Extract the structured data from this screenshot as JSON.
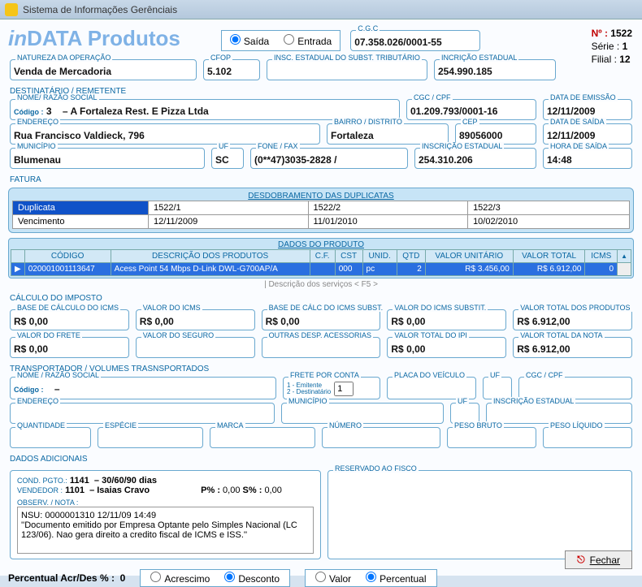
{
  "window": {
    "title": "Sistema de Informações Gerênciais"
  },
  "brand": {
    "prefix": "in",
    "rest": "DATA Produtos"
  },
  "direction": {
    "out": "Saída",
    "in": "Entrada",
    "selected": "out"
  },
  "header": {
    "cgc": {
      "label": "C.G.C",
      "value": "07.358.026/0001-55"
    },
    "natureza": {
      "label": "NATUREZA DA OPERAÇÃO",
      "value": "Venda de Mercadoria"
    },
    "cfop": {
      "label": "CFOP",
      "value": "5.102"
    },
    "insc_subst": {
      "label": "INSC. ESTADUAL DO SUBST. TRIBUTÁRIO",
      "value": ""
    },
    "insc_est": {
      "label": "INCRIÇÃO ESTADUAL",
      "value": "254.990.185"
    },
    "numero": {
      "label": "Nº :",
      "value": "1522"
    },
    "serie": {
      "label": "Série :",
      "value": "1"
    },
    "filial": {
      "label": "Filial :",
      "value": "12"
    }
  },
  "dest": {
    "title": "DESTINATÁRIO / REMETENTE",
    "nome": {
      "label": "NOME/ RAZÃO SOCIAL",
      "code_lbl": "Código :",
      "code": "3",
      "dash": "–",
      "value": "A Fortaleza Rest. E Pizza Ltda"
    },
    "cgc_cpf": {
      "label": "CGC / CPF",
      "value": "01.209.793/0001-16"
    },
    "data_emissao": {
      "label": "DATA DE EMISSÃO",
      "value": "12/11/2009"
    },
    "endereco": {
      "label": "ENDEREÇO",
      "value": "Rua Francisco Valdieck, 796"
    },
    "bairro": {
      "label": "BAIRRO / DISTRITO",
      "value": "Fortaleza"
    },
    "cep": {
      "label": "CEP",
      "value": "89056000"
    },
    "data_saida": {
      "label": "DATA DE SAÍDA",
      "value": "12/11/2009"
    },
    "municipio": {
      "label": "MUNICÍPIO",
      "value": "Blumenau"
    },
    "uf": {
      "label": "UF",
      "value": "SC"
    },
    "fone": {
      "label": "FONE / FAX",
      "value": "(0**47)3035-2828 /"
    },
    "insc_est": {
      "label": "INSCRIÇÃO ESTADUAL",
      "value": "254.310.206"
    },
    "hora_saida": {
      "label": "HORA DE SAÍDA",
      "value": "14:48"
    }
  },
  "fatura": {
    "title": "FATURA",
    "desdo": "DESDOBRAMENTO DAS DUPLICATAS",
    "rows": [
      {
        "h": "Duplicata",
        "c1": "1522/1",
        "c2": "1522/2",
        "c3": "1522/3"
      },
      {
        "h": "Vencimento",
        "c1": "12/11/2009",
        "c2": "11/01/2010",
        "c3": "10/02/2010"
      }
    ]
  },
  "produtos": {
    "title": "DADOS DO PRODUTO",
    "cols": {
      "codigo": "CÓDIGO",
      "desc": "DESCRIÇÃO DOS PRODUTOS",
      "cf": "C.F.",
      "cst": "CST",
      "unid": "UNID.",
      "qtd": "QTD",
      "vunit": "VALOR UNITÁRIO",
      "vtot": "VALOR TOTAL",
      "icms": "ICMS"
    },
    "rows": [
      {
        "codigo": "020001001113647",
        "desc": "Acess Point 54 Mbps D-Link DWL-G700AP/A",
        "cf": "",
        "cst": "000",
        "unid": "pc",
        "qtd": "2",
        "vunit": "R$ 3.456,00",
        "vtot": "R$ 6.912,00",
        "icms": "0"
      }
    ],
    "svc_hint": "| Descrição dos serviços < F5 >"
  },
  "calculo": {
    "title": "CÁLCULO DO IMPOSTO",
    "base_icms": {
      "label": "BASE DE CÁLCULO DO ICMS",
      "value": "R$ 0,00"
    },
    "valor_icms": {
      "label": "VALOR DO ICMS",
      "value": "R$ 0,00"
    },
    "base_subst": {
      "label": "BASE DE CÁLC DO ICMS SUBST.",
      "value": "R$ 0,00"
    },
    "valor_subst": {
      "label": "VALOR DO ICMS SUBSTIT.",
      "value": "R$ 0,00"
    },
    "total_prod": {
      "label": "VALOR TOTAL DOS PRODUTOS",
      "value": "R$ 6.912,00"
    },
    "frete": {
      "label": "VALOR DO FRETE",
      "value": "R$ 0,00"
    },
    "seguro": {
      "label": "VALOR DO SEGURO",
      "value": ""
    },
    "outras": {
      "label": "OUTRAS DESP. ACESSORIAS",
      "value": ""
    },
    "ipi": {
      "label": "VALOR TOTAL DO IPI",
      "value": "R$ 0,00"
    },
    "total_nota": {
      "label": "VALOR TOTAL DA NOTA",
      "value": "R$ 6.912,00"
    }
  },
  "transp": {
    "title": "TRANSPORTADOR / VOLUMES TRASNSPORTADOS",
    "nome": {
      "label": "NOME / RAZÃO SOCIAL",
      "code_lbl": "Código :",
      "value": "–"
    },
    "frete_conta": {
      "label": "FRETE POR CONTA",
      "hint1": "1 - Emitente",
      "hint2": "2 - Destinatário",
      "value": "1"
    },
    "placa": {
      "label": "PLACA DO VEÍCULO",
      "value": ""
    },
    "uf1": {
      "label": "UF",
      "value": ""
    },
    "cgc": {
      "label": "CGC / CPF",
      "value": ""
    },
    "endereco": {
      "label": "ENDEREÇO",
      "value": ""
    },
    "municipio": {
      "label": "MUNICÍPIO",
      "value": ""
    },
    "uf2": {
      "label": "UF",
      "value": ""
    },
    "insc": {
      "label": "INSCRIÇÃO ESTADUAL",
      "value": ""
    },
    "qtd": {
      "label": "QUANTIDADE",
      "value": ""
    },
    "especie": {
      "label": "ESPÉCIE",
      "value": ""
    },
    "marca": {
      "label": "MARCA",
      "value": ""
    },
    "numero": {
      "label": "NÚMERO",
      "value": ""
    },
    "peso_bruto": {
      "label": "PESO BRUTO",
      "value": ""
    },
    "peso_liq": {
      "label": "PESO LÍQUIDO",
      "value": ""
    }
  },
  "adicionais": {
    "title": "DADOS ADICIONAIS",
    "cond_pgto_lbl": "COND. PGTO.:",
    "cond_pgto_code": "1141",
    "cond_pgto_desc": "– 30/60/90 dias",
    "vendedor_lbl": "VENDEDOR :",
    "vendedor_code": "1101",
    "vendedor_desc": "– Isaias Cravo",
    "p_lbl": "P% :",
    "p_val": "0,00",
    "s_lbl": "S% :",
    "s_val": "0,00",
    "observ_lbl": "OBSERV. / NOTA :",
    "observ": "NSU: 0000001310 12/11/09 14:49\n''Documento emitido por Empresa Optante pelo Simples Nacional (LC 123/06). Nao gera direito a credito fiscal de ICMS e ISS.''",
    "fisco": {
      "label": "RESERVADO AO FISCO",
      "value": ""
    }
  },
  "bottom": {
    "perc_lbl": "Percentual Acr/Des % :",
    "perc_val": "0",
    "r1": {
      "a": "Acrescimo",
      "b": "Desconto",
      "selected": "b"
    },
    "r2": {
      "a": "Valor",
      "b": "Percentual",
      "selected": "b"
    },
    "close": "Fechar"
  }
}
